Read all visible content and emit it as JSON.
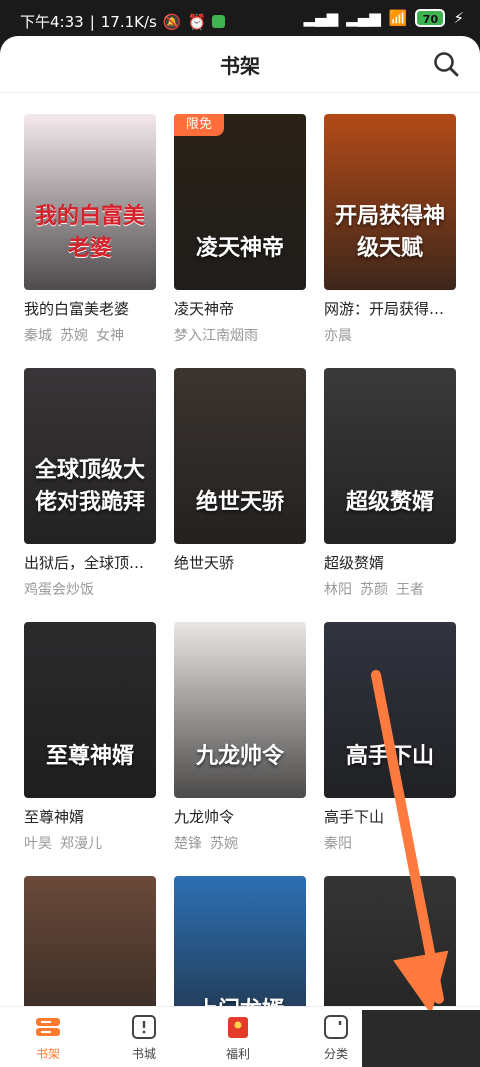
{
  "status": {
    "time": "下午4:33",
    "speed": "17.1K/s",
    "battery": "70"
  },
  "header": {
    "title": "书架"
  },
  "badges": {
    "free": "限免"
  },
  "books": [
    {
      "title": "我的白富美老婆",
      "tags": [
        "秦城",
        "苏婉",
        "女神"
      ],
      "cover_text": "我的白富美老婆",
      "cover_color": "#f4e9ec"
    },
    {
      "title": "凌天神帝",
      "tags": [
        "梦入江南烟雨"
      ],
      "cover_text": "凌天神帝",
      "cover_color": "#2b2218"
    },
    {
      "title": "网游：开局获得…",
      "tags": [
        "亦晨"
      ],
      "cover_text": "开局获得神级天赋",
      "cover_color": "#b44a18"
    },
    {
      "title": "出狱后，全球顶…",
      "tags": [
        "鸡蛋会炒饭"
      ],
      "cover_text": "全球顶级大佬对我跪拜",
      "cover_color": "#3a3538"
    },
    {
      "title": "绝世天骄",
      "tags": [],
      "cover_text": "绝世天骄",
      "cover_color": "#3b342f"
    },
    {
      "title": "超级赘婿",
      "tags": [
        "林阳",
        "苏颜",
        "王者"
      ],
      "cover_text": "超级赘婿",
      "cover_color": "#3a3a3a"
    },
    {
      "title": "至尊神婿",
      "tags": [
        "叶昊",
        "郑漫儿"
      ],
      "cover_text": "至尊神婿",
      "cover_color": "#2b2a2c"
    },
    {
      "title": "九龙帅令",
      "tags": [
        "楚锋",
        "苏婉"
      ],
      "cover_text": "九龙帅令",
      "cover_color": "#e9e6e3"
    },
    {
      "title": "高手下山",
      "tags": [
        "秦阳"
      ],
      "cover_text": "高手下山",
      "cover_color": "#30343f"
    },
    {
      "title": "",
      "tags": [],
      "cover_text": "",
      "cover_color": "#6b4a3a"
    },
    {
      "title": "",
      "tags": [],
      "cover_text": "上门龙婿",
      "cover_color": "#2d6fb4"
    },
    {
      "title": "",
      "tags": [],
      "cover_text": "",
      "cover_color": "#353535"
    }
  ],
  "tabs": [
    {
      "label": "书架",
      "icon": "bookshelf-icon"
    },
    {
      "label": "书城",
      "icon": "book-city-icon"
    },
    {
      "label": "福利",
      "icon": "gift-icon"
    },
    {
      "label": "分类",
      "icon": "category-icon"
    }
  ],
  "colors": {
    "accent": "#ff7a2f",
    "annotation_arrow": "#ff7a3f"
  }
}
